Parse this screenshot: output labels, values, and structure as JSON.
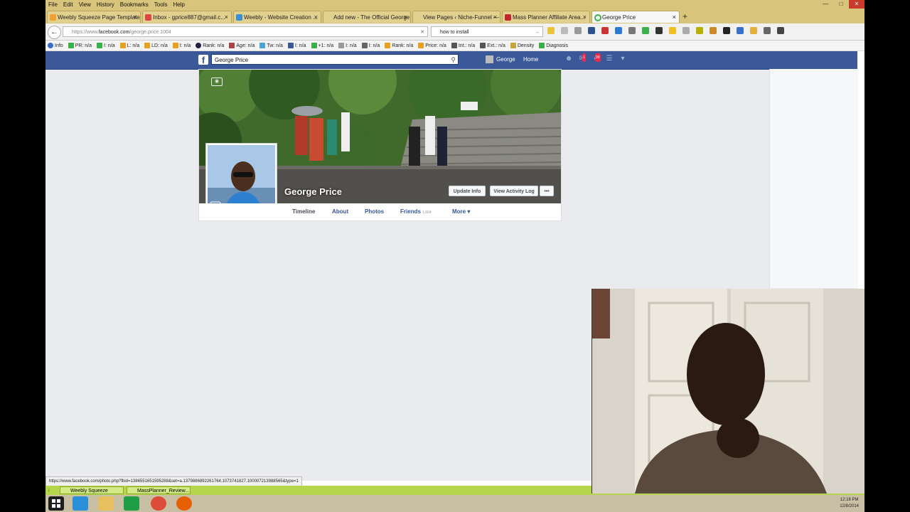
{
  "menu": [
    "File",
    "Edit",
    "View",
    "History",
    "Bookmarks",
    "Tools",
    "Help"
  ],
  "tabs": [
    {
      "label": "Weebly Squeeze Page Template",
      "color": "#f0a030"
    },
    {
      "label": "Inbox - gprice887@gmail.c...",
      "color": "#d44"
    },
    {
      "label": "Weebly - Website Creation ...",
      "color": "#3a8fd8"
    },
    {
      "label": "Add new - The Official George...",
      "color": "#ccc"
    },
    {
      "label": "View Pages ‹ Niche-Funnel — ...",
      "color": "#ccc"
    },
    {
      "label": "Mass Planner Affiliate Area...",
      "color": "#c1272d"
    },
    {
      "label": "George Price",
      "color": "#3b5998"
    }
  ],
  "nav": {
    "url_prefix": "https://www.",
    "url_domain": "facebook.com",
    "url_path": "/george.price.1004",
    "search_value": "how to install"
  },
  "seo": [
    "Info",
    "PR: n/a",
    "I: n/a",
    "L: n/a",
    "LD: n/a",
    "I: n/a",
    "Rank: n/a",
    "Age: n/a",
    "Tw: n/a",
    "I: n/a",
    "+1: n/a",
    "I: n/a",
    "I: n/a",
    "Rank: n/a",
    "Price: n/a",
    "Int.: n/a",
    "Ext.: n/a",
    "Density",
    "Diagnosis"
  ],
  "fb": {
    "search_value": "George Price",
    "user": "George",
    "home": "Home",
    "notif_count": "99",
    "friend_count": "1"
  },
  "profile": {
    "name": "George Price",
    "update_info": "Update Info",
    "activity_log": "View Activity Log",
    "more_dots": "•••",
    "tabs": {
      "timeline": "Timeline",
      "about": "About",
      "photos": "Photos",
      "friends": "Friends",
      "friends_count": "1,604",
      "more": "More ▾"
    }
  },
  "status_url": "https://www.facebook.com/photo.php?fbid=1386551651595288&set=a.1379886892261764.1073741827.100007213988565&type=1",
  "downloads": [
    "Weebly Squeeze Pag...",
    "MassPlanner_Review..."
  ],
  "clock": {
    "time": "12:18 PM",
    "date": "12/8/2014"
  }
}
